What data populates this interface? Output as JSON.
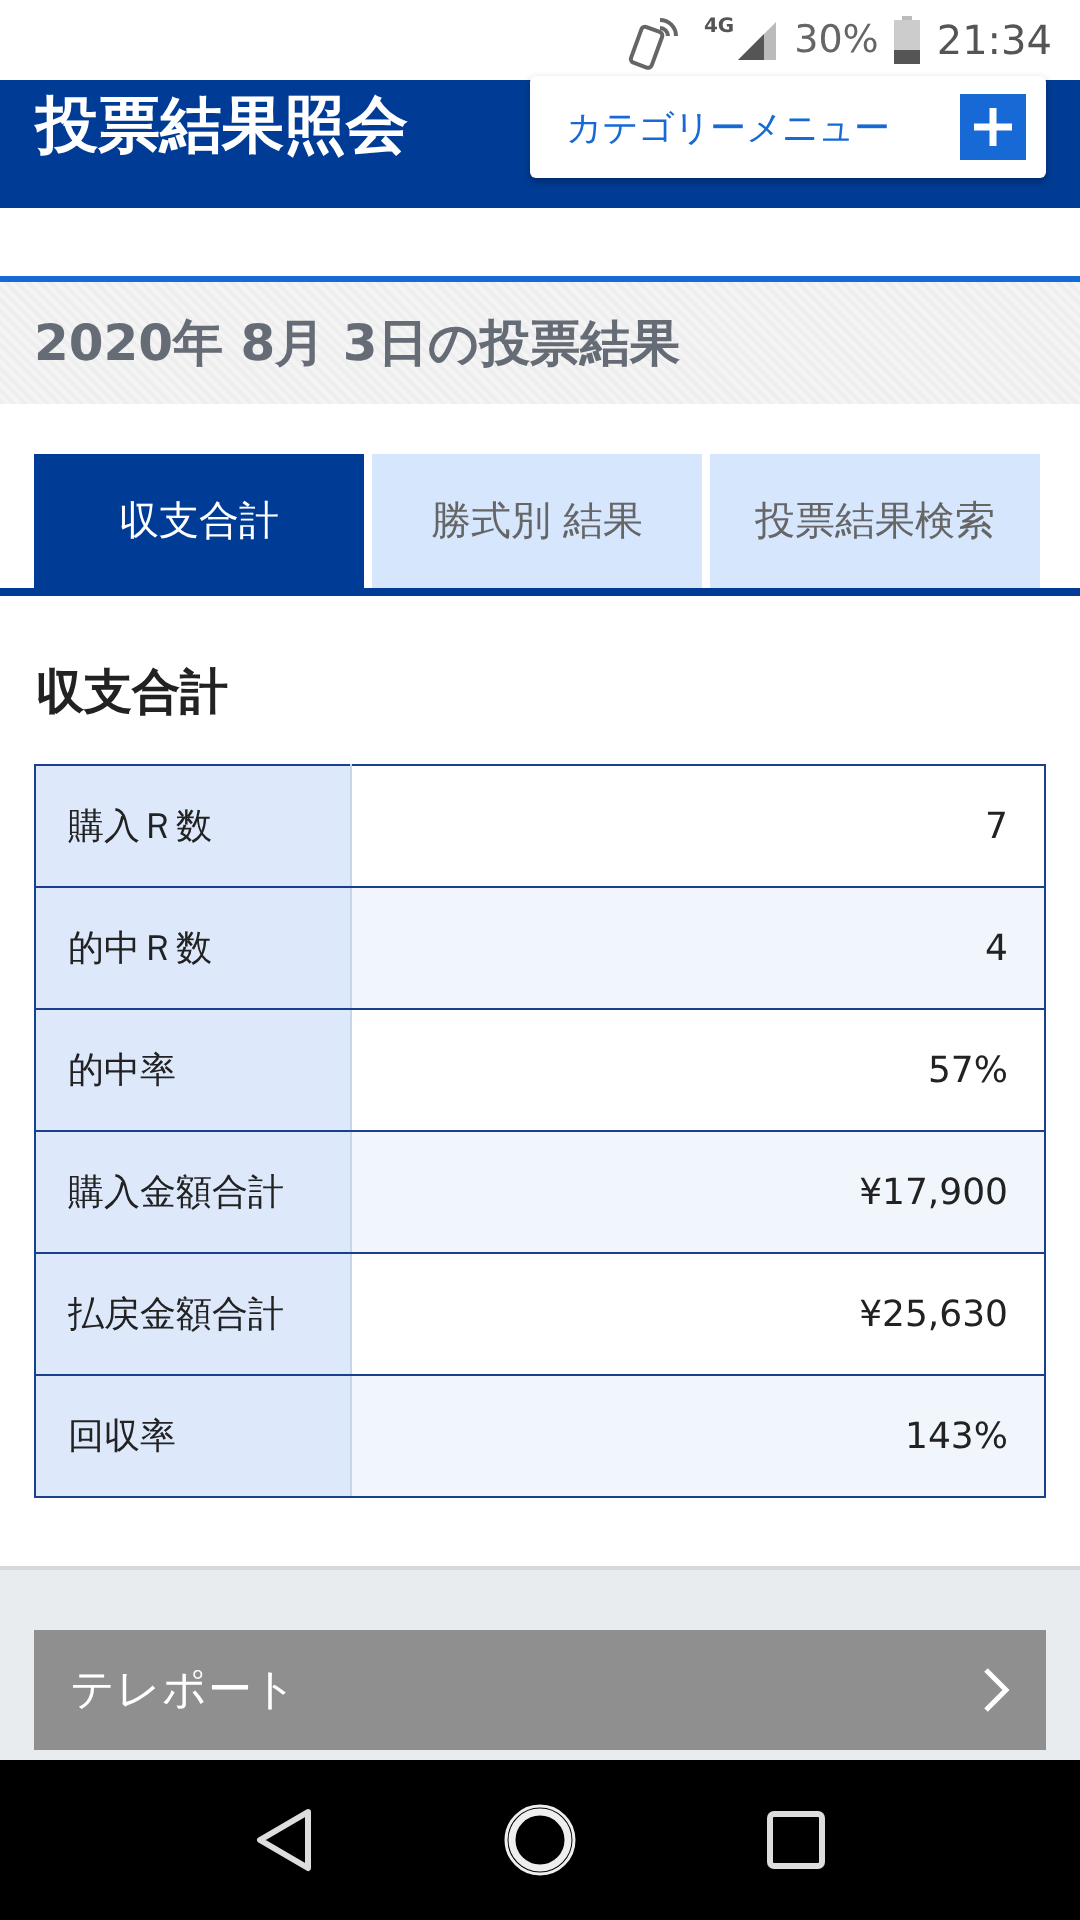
{
  "status_bar": {
    "battery": "30%",
    "time": "21:34",
    "network": "4G"
  },
  "header": {
    "title": "投票結果照会",
    "menu_button": "カテゴリーメニュー"
  },
  "date_heading": "2020年 8月 3日の投票結果",
  "tabs": [
    {
      "label": "収支合計",
      "selected": true
    },
    {
      "label": "勝式別 結果",
      "selected": false
    },
    {
      "label": "投票結果検索",
      "selected": false
    }
  ],
  "section_title": "収支合計",
  "table": {
    "rows": [
      {
        "label": "購入Ｒ数",
        "value": "7"
      },
      {
        "label": "的中Ｒ数",
        "value": "4"
      },
      {
        "label": "的中率",
        "value": "57%"
      },
      {
        "label": "購入金額合計",
        "value": "¥17,900"
      },
      {
        "label": "払戻金額合計",
        "value": "¥25,630"
      },
      {
        "label": "回収率",
        "value": "143%"
      }
    ]
  },
  "link_button": "テレポート"
}
